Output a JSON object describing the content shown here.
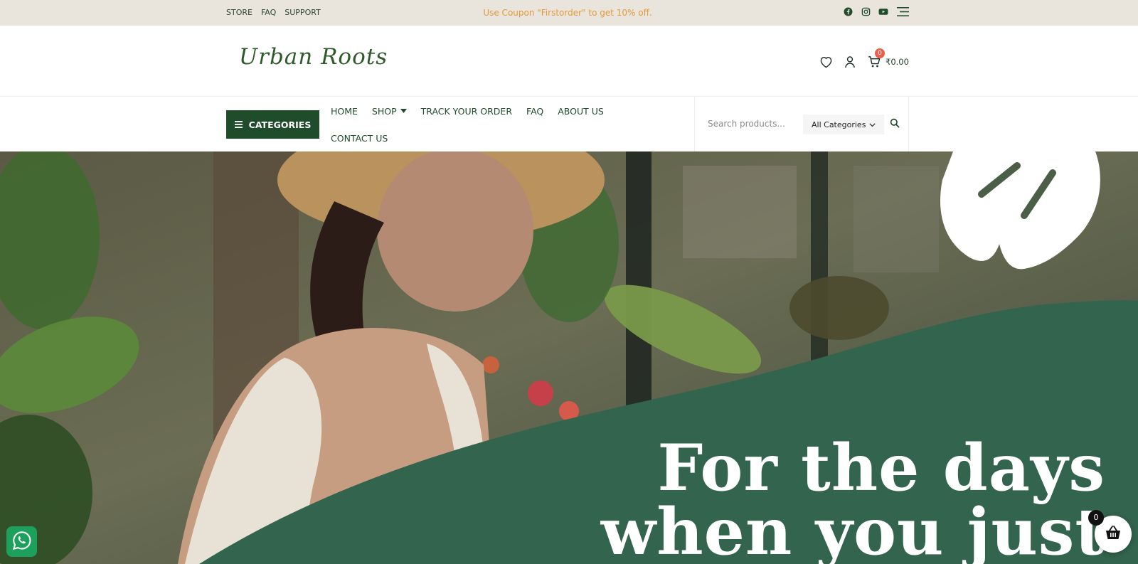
{
  "topbar": {
    "links": [
      "STORE",
      "FAQ",
      "SUPPORT"
    ],
    "coupon": "Use Coupon \"Firstorder\" to get 10% off.",
    "socials": [
      "facebook-icon",
      "instagram-icon",
      "youtube-icon",
      "menu-lines-icon"
    ]
  },
  "header": {
    "logo_text": "Urban Roots",
    "cart_count": "0",
    "cart_total": "₹0.00"
  },
  "nav": {
    "categories_label": "CATEGORIES",
    "menu_row1": [
      "HOME",
      "SHOP",
      "TRACK YOUR ORDER",
      "FAQ",
      "ABOUT US"
    ],
    "menu_row2": [
      "CONTACT US"
    ],
    "search_placeholder": "Search products...",
    "category_select": "All Categories"
  },
  "hero": {
    "heading_line1": "For the days",
    "heading_line2": "when you just"
  },
  "floating": {
    "cart_count": "0"
  },
  "colors": {
    "brand_green": "#1f4d2b",
    "hero_green": "#33644d",
    "coupon_orange": "#e39a3a",
    "topbar_bg": "#e9e4dc",
    "badge_red": "#e8604c"
  }
}
